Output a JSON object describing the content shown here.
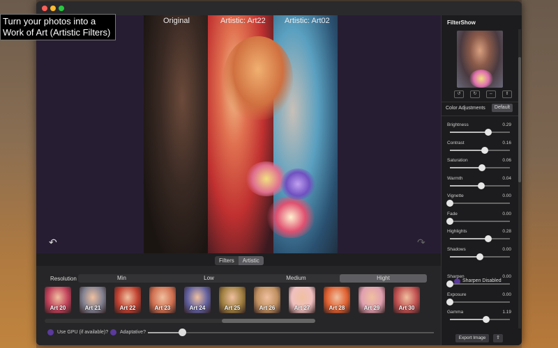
{
  "promo": {
    "line1": "Turn your photos into a",
    "line2": "Work of Art  (Artistic Filters)"
  },
  "canvas": {
    "labels": [
      "Original",
      "Artistic: Art22",
      "Artistic: Art02"
    ],
    "undo_icon": "↶",
    "redo_icon": "↷"
  },
  "mode_tabs": [
    {
      "label": "Filters",
      "active": false
    },
    {
      "label": "Artistic",
      "active": true
    }
  ],
  "resolution": {
    "label": "Resolution",
    "options": [
      "Min",
      "Low",
      "Medium",
      "Hight"
    ],
    "selected": "Hight"
  },
  "thumbnails": [
    "Art 20",
    "Art 21",
    "Art 22",
    "Art 23",
    "Art 24",
    "Art 25",
    "Art 26",
    "Art 27",
    "Art 28",
    "Art 29",
    "Art 30"
  ],
  "thumbnail_colors": [
    "#c0405a",
    "#808090",
    "#c04030",
    "#d07050",
    "#6060a0",
    "#a08040",
    "#c09060",
    "#f0c0c0",
    "#e06030",
    "#e0a0b0",
    "#c05050"
  ],
  "options": {
    "gpu_label": "Use GPU (if available)?",
    "adaptive_label": "Adaptative?",
    "gpu_checked": true,
    "adaptive_checked": true,
    "slider_fraction": 0.12
  },
  "panel": {
    "title": "FilterShow",
    "tools": [
      "↺",
      "↻",
      "⇔",
      "⇕"
    ],
    "color_adjustments_label": "Color Adjustments",
    "default_label": "Default",
    "adjustments": [
      {
        "name": "Brightness",
        "value": "0.29",
        "fraction": 0.64
      },
      {
        "name": "Contrast",
        "value": "0.16",
        "fraction": 0.58
      },
      {
        "name": "Saturation",
        "value": "0.06",
        "fraction": 0.53
      },
      {
        "name": "Warmth",
        "value": "0.04",
        "fraction": 0.52
      },
      {
        "name": "Vignette",
        "value": "0.00",
        "fraction": 0.0
      },
      {
        "name": "Fade",
        "value": "0.00",
        "fraction": 0.0
      },
      {
        "name": "Highlights",
        "value": "0.28",
        "fraction": 0.64
      },
      {
        "name": "Shadows",
        "value": "0.00",
        "fraction": 0.5
      }
    ],
    "sharpen_label": "Sharpen Disabled",
    "adjustments2": [
      {
        "name": "Sharpen",
        "value": "0.00",
        "fraction": 0.0
      },
      {
        "name": "Exposure",
        "value": "0.00",
        "fraction": 0.0
      },
      {
        "name": "Gamma",
        "value": "1.19",
        "fraction": 0.6
      }
    ],
    "export_label": "Export Image",
    "share_icon": "⇪"
  }
}
